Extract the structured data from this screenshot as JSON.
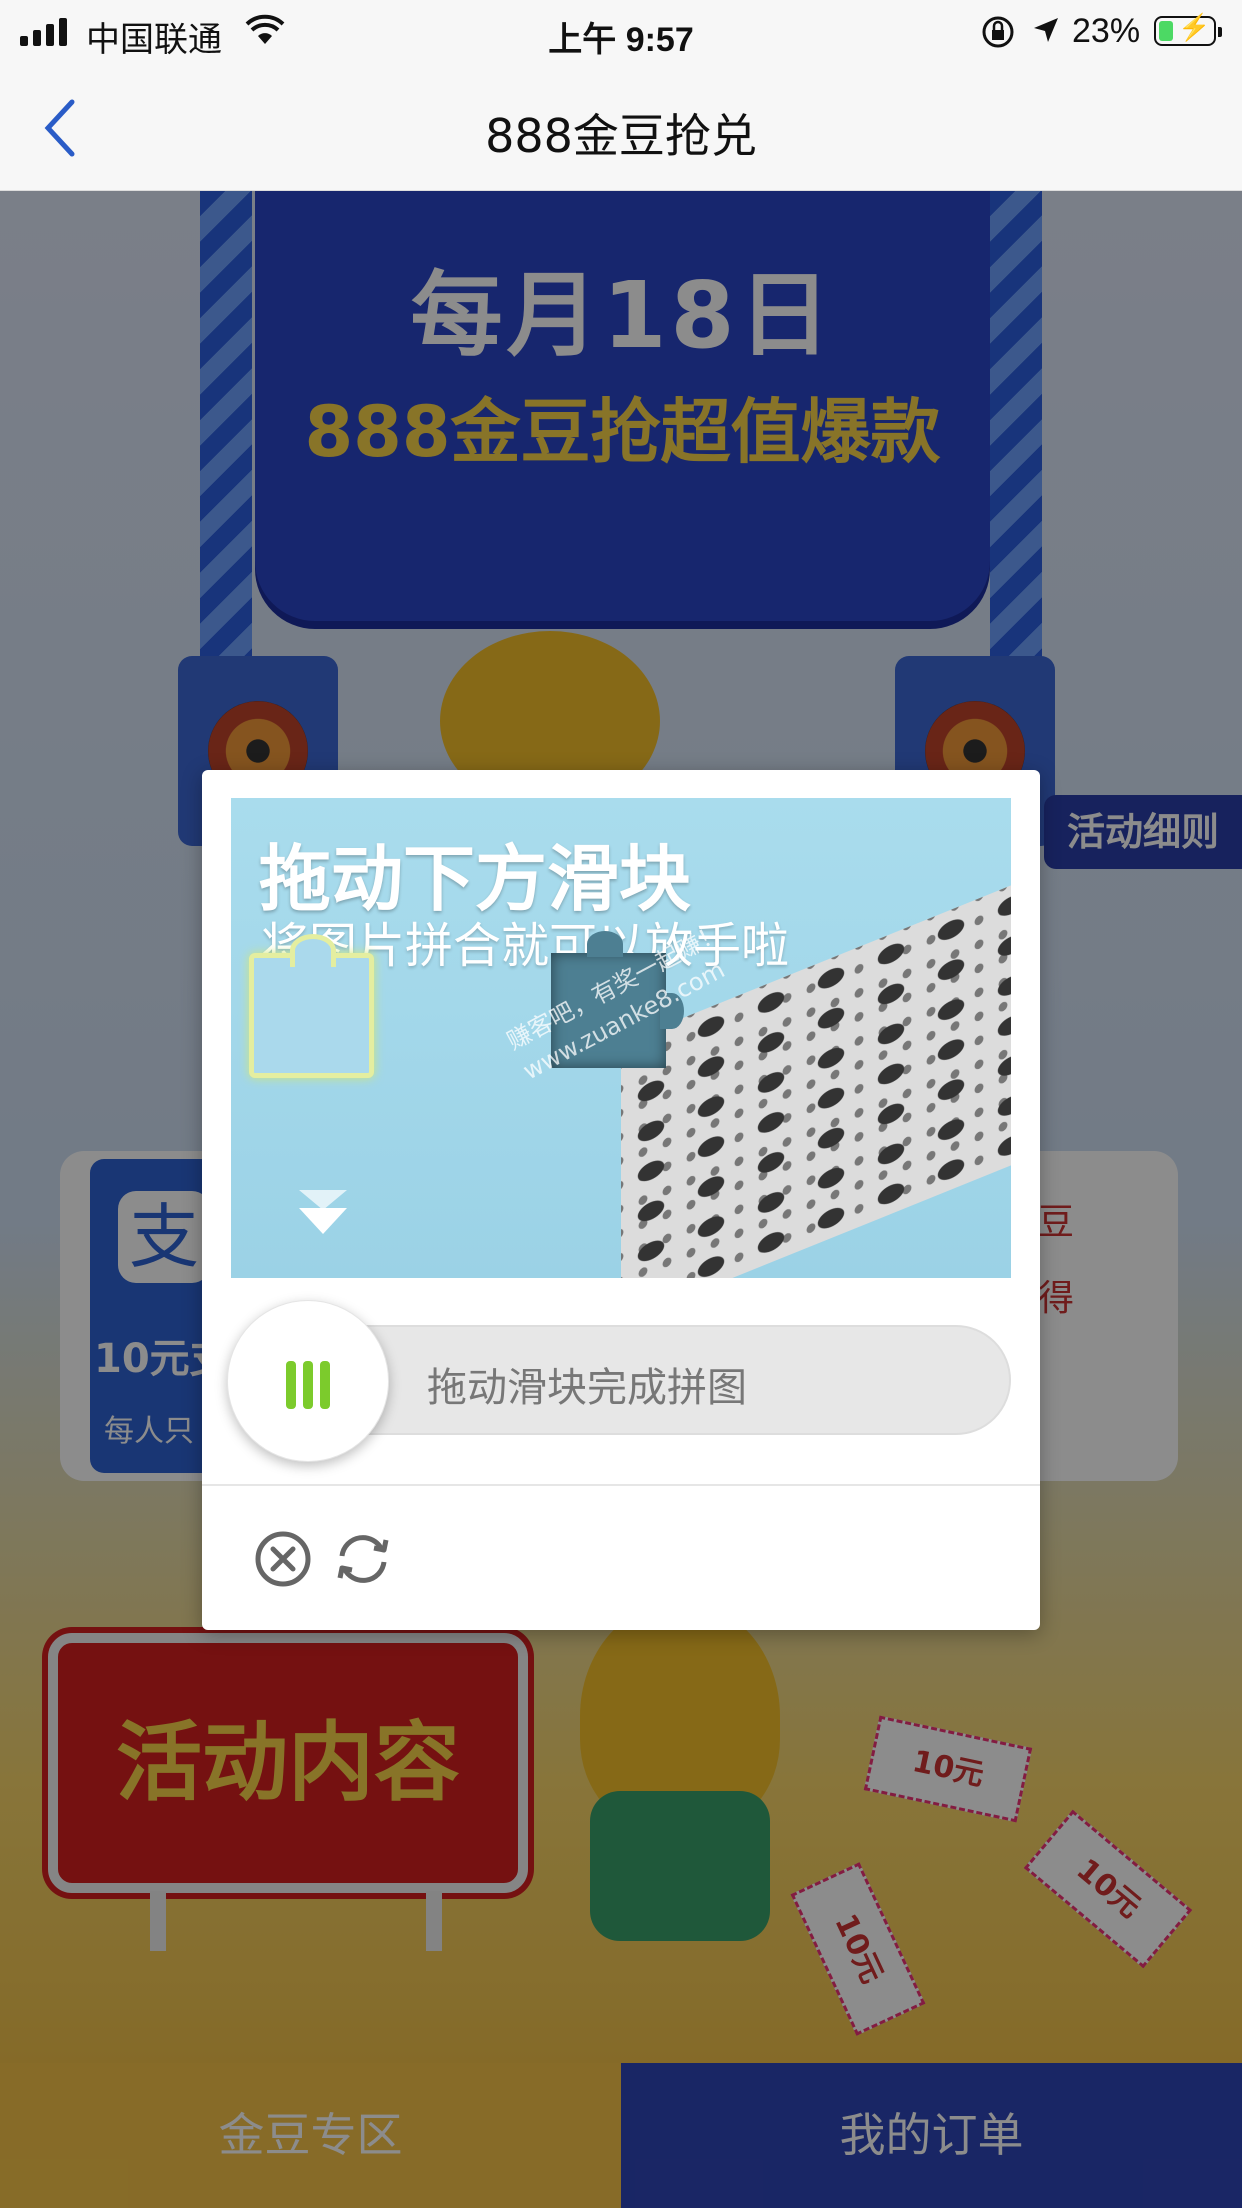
{
  "status_bar": {
    "carrier": "中国联通",
    "time": "上午 9:57",
    "battery_percent": "23%",
    "icons": [
      "signal-icon",
      "wifi-icon",
      "orientation-lock-icon",
      "location-arrow-icon",
      "battery-charging-icon"
    ]
  },
  "nav": {
    "title": "888金豆抢兑",
    "back_icon": "chevron-left-icon"
  },
  "background_page": {
    "banner_line1": "每月18日",
    "banner_line2": "888金豆抢超值爆款",
    "rules_button": "活动细则",
    "card": {
      "left_label": "10元支",
      "left_sub": "每人只",
      "right_line1": "豆",
      "right_line2": "得"
    },
    "activity_sign": "活动内容",
    "tickets": [
      "10元",
      "10元",
      "10元"
    ]
  },
  "tabs": {
    "left": "金豆专区",
    "right": "我的订单"
  },
  "captcha": {
    "image_title": "拖动下方滑块",
    "image_subtitle": "将图片拼合就可以放手啦",
    "watermark_line1": "赚客吧，有奖一起赚！",
    "watermark_line2": "www.zuanke8.com",
    "slider_hint": "拖动滑块完成拼图",
    "close_icon": "close-circle-icon",
    "refresh_icon": "refresh-icon",
    "accent_color": "#7ccb2c"
  }
}
